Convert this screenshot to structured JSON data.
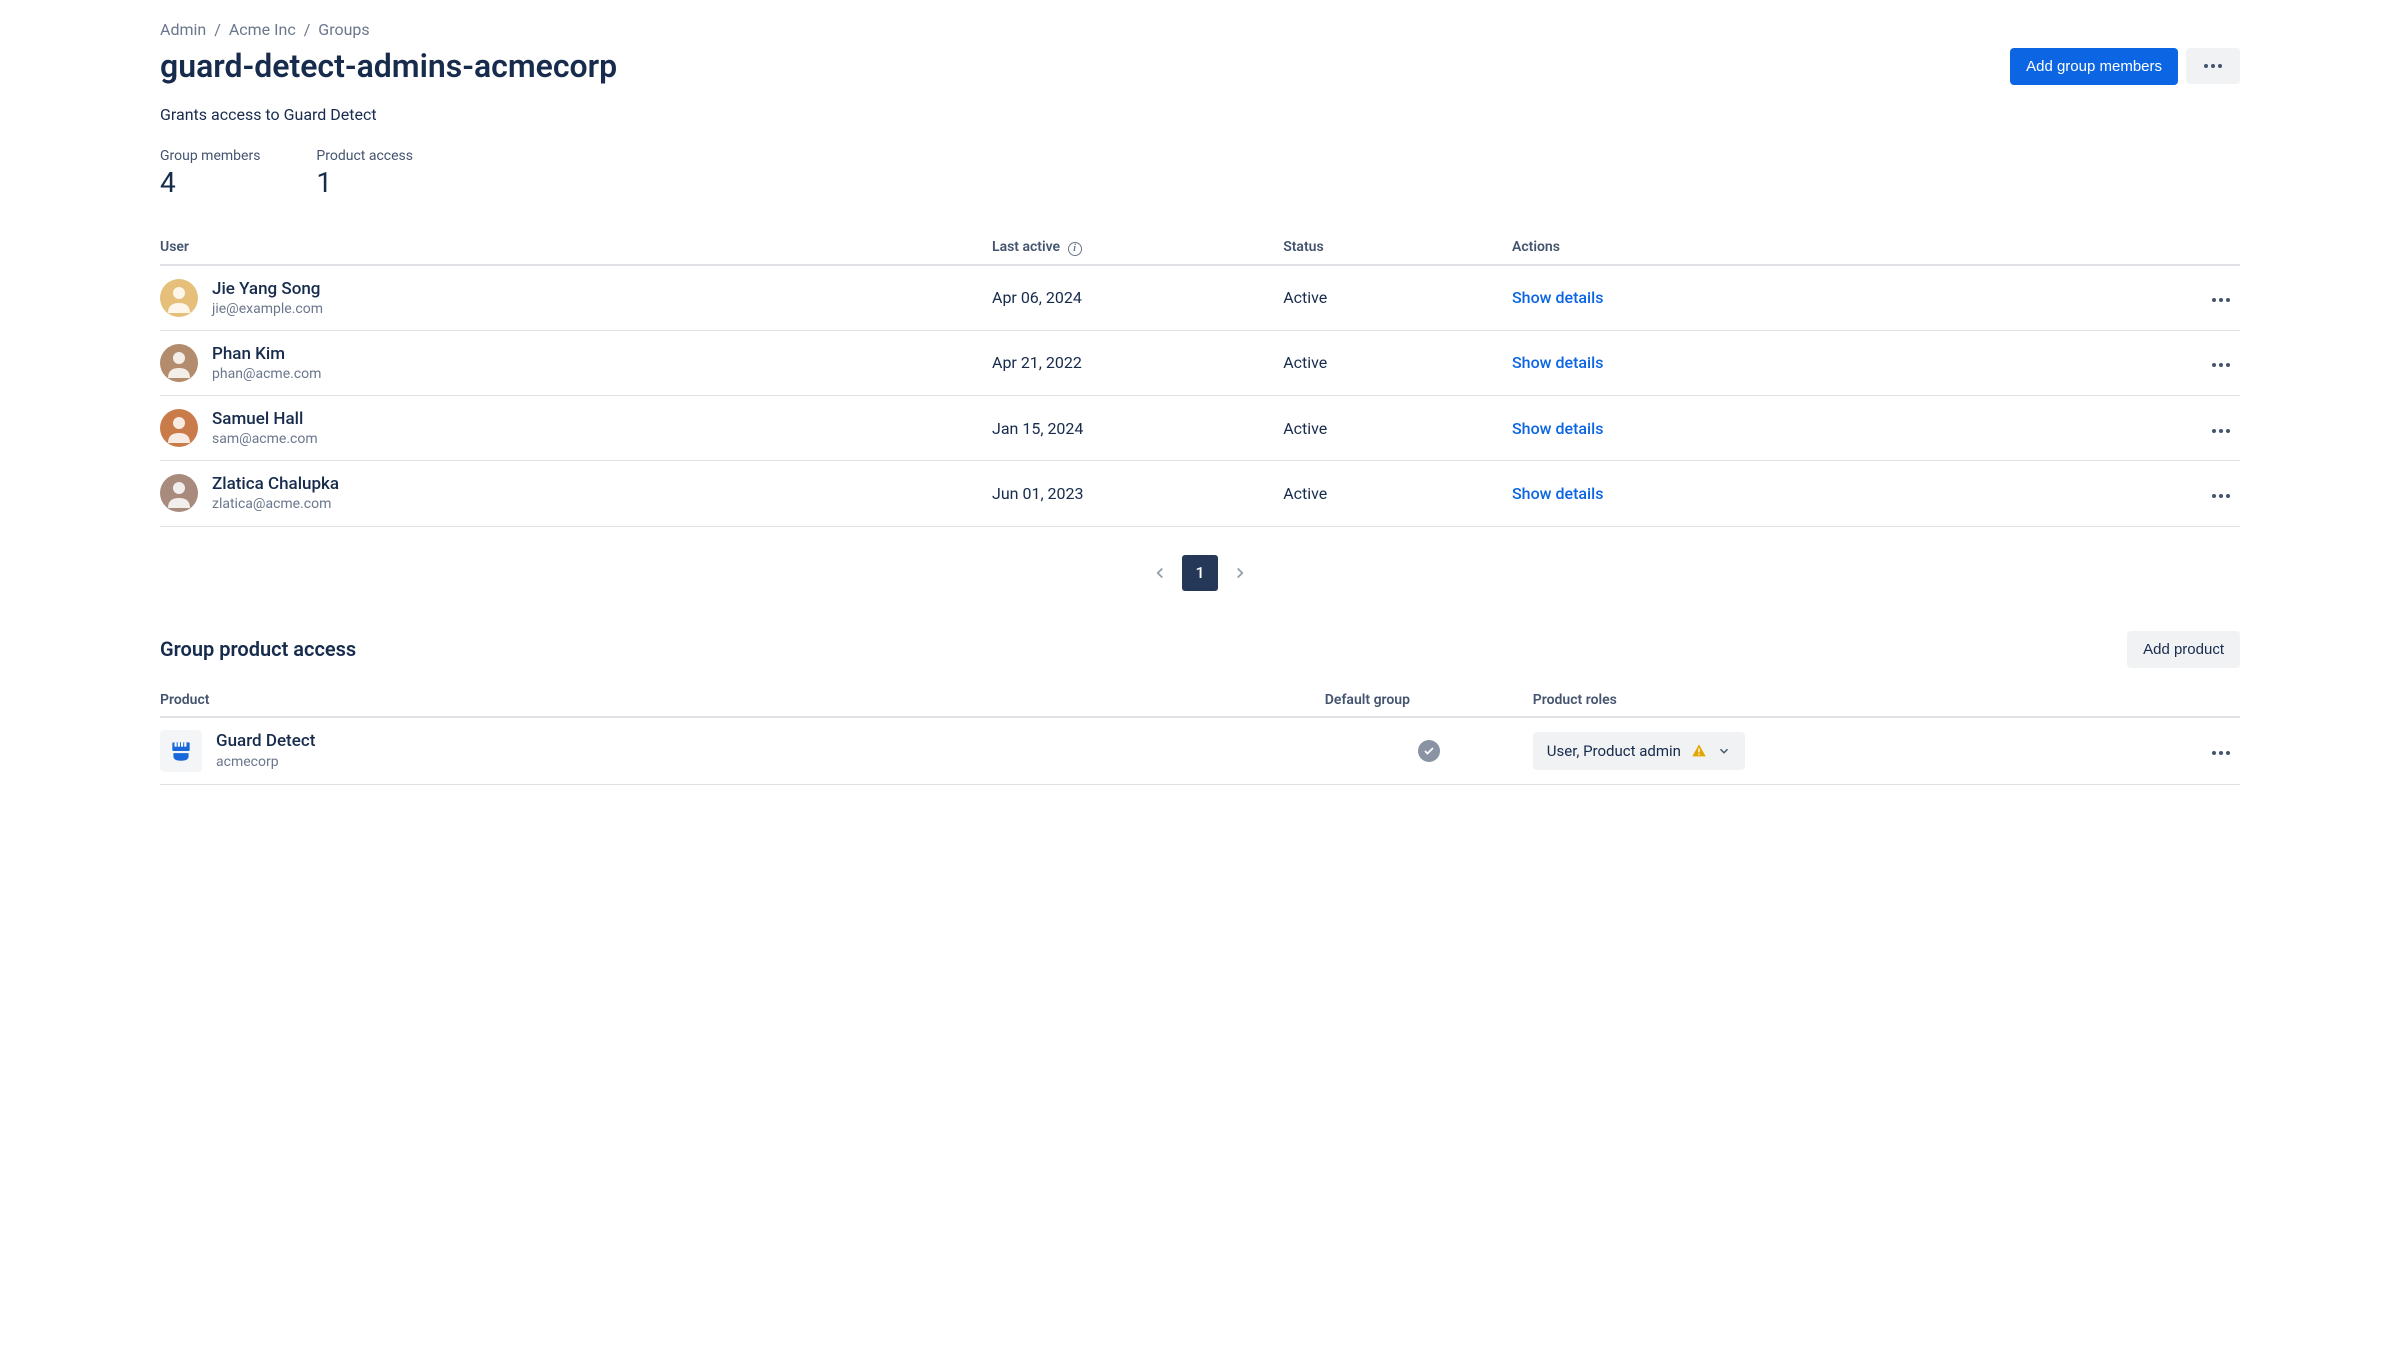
{
  "breadcrumb": [
    {
      "label": "Admin"
    },
    {
      "label": "Acme Inc"
    },
    {
      "label": "Groups"
    }
  ],
  "page_title": "guard-detect-admins-acmecorp",
  "add_members_label": "Add group members",
  "description": "Grants access to Guard Detect",
  "stats": {
    "members_label": "Group members",
    "members_value": "4",
    "access_label": "Product access",
    "access_value": "1"
  },
  "users_table": {
    "headers": {
      "user": "User",
      "last_active": "Last active",
      "status": "Status",
      "actions": "Actions"
    },
    "show_details_label": "Show details",
    "rows": [
      {
        "name": "Jie Yang Song",
        "email": "jie@example.com",
        "last_active": "Apr 06, 2024",
        "status": "Active",
        "avatar_bg": "#E6C07B"
      },
      {
        "name": "Phan Kim",
        "email": "phan@acme.com",
        "last_active": "Apr 21, 2022",
        "status": "Active",
        "avatar_bg": "#B38B6D"
      },
      {
        "name": "Samuel Hall",
        "email": "sam@acme.com",
        "last_active": "Jan 15, 2024",
        "status": "Active",
        "avatar_bg": "#C97B4A"
      },
      {
        "name": "Zlatica Chalupka",
        "email": "zlatica@acme.com",
        "last_active": "Jun 01, 2023",
        "status": "Active",
        "avatar_bg": "#A88B7D"
      }
    ]
  },
  "pagination": {
    "current": "1"
  },
  "product_section": {
    "title": "Group product access",
    "add_product_label": "Add product",
    "headers": {
      "product": "Product",
      "default_group": "Default group",
      "product_roles": "Product roles"
    },
    "rows": [
      {
        "name": "Guard Detect",
        "org": "acmecorp",
        "roles": "User, Product admin"
      }
    ]
  }
}
